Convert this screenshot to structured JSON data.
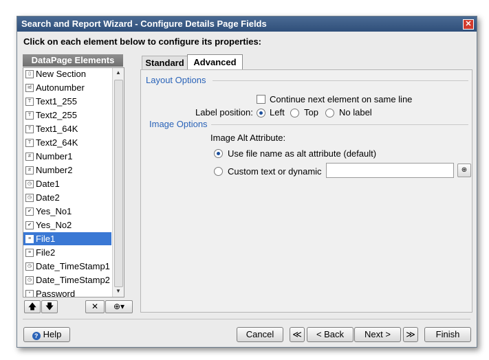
{
  "window": {
    "title": "Search and Report Wizard - Configure Details Page Fields",
    "close_glyph": "✕"
  },
  "instruction": "Click on each element below to configure its properties:",
  "left_panel": {
    "header": "DataPage Elements",
    "items": [
      {
        "label": "New Section",
        "icon": "section-icon",
        "glyph": "▯"
      },
      {
        "label": "Autonumber",
        "icon": "autonumber-icon",
        "glyph": "id"
      },
      {
        "label": "Text1_255",
        "icon": "text-field-icon",
        "glyph": "T"
      },
      {
        "label": "Text2_255",
        "icon": "text-field-icon",
        "glyph": "T"
      },
      {
        "label": "Text1_64K",
        "icon": "memo-field-icon",
        "glyph": "T"
      },
      {
        "label": "Text2_64K",
        "icon": "memo-field-icon",
        "glyph": "T"
      },
      {
        "label": "Number1",
        "icon": "number-field-icon",
        "glyph": "#"
      },
      {
        "label": "Number2",
        "icon": "number-field-icon",
        "glyph": "#"
      },
      {
        "label": "Date1",
        "icon": "date-field-icon",
        "glyph": "◷"
      },
      {
        "label": "Date2",
        "icon": "date-field-icon",
        "glyph": "◷"
      },
      {
        "label": "Yes_No1",
        "icon": "checkbox-field-icon",
        "glyph": "✔"
      },
      {
        "label": "Yes_No2",
        "icon": "checkbox-field-icon",
        "glyph": "✔"
      },
      {
        "label": "File1",
        "icon": "file-field-icon",
        "glyph": "≡",
        "selected": true
      },
      {
        "label": "File2",
        "icon": "file-field-icon",
        "glyph": "≡"
      },
      {
        "label": "Date_TimeStamp1",
        "icon": "timestamp-field-icon",
        "glyph": "◷"
      },
      {
        "label": "Date_TimeStamp2",
        "icon": "timestamp-field-icon",
        "glyph": "◷"
      },
      {
        "label": "Password",
        "icon": "password-field-icon",
        "glyph": "*"
      }
    ],
    "tools": {
      "up": "🡅",
      "down": "🡇",
      "delete": "✕",
      "insert": "⊕▾"
    }
  },
  "tabs": [
    {
      "label": "Standard"
    },
    {
      "label": "Advanced",
      "active": true
    }
  ],
  "layout_options": {
    "section_label": "Layout Options",
    "continue_checkbox_label": "Continue next element on same line",
    "continue_checked": false,
    "label_position_label": "Label position:",
    "positions": [
      {
        "label": "Left",
        "selected": true
      },
      {
        "label": "Top",
        "selected": false
      },
      {
        "label": "No label",
        "selected": false
      }
    ]
  },
  "image_options": {
    "section_label": "Image Options",
    "alt_attribute_label": "Image Alt Attribute:",
    "option_filename": "Use file name as alt attribute (default)",
    "option_custom": "Custom text or dynamic",
    "custom_value": "",
    "picker_glyph": "⊕"
  },
  "footer": {
    "help": "Help",
    "cancel": "Cancel",
    "first": "≪",
    "back": "< Back",
    "next": "Next >",
    "last": "≫",
    "finish": "Finish"
  },
  "colors": {
    "accent": "#2a63b8",
    "selection": "#3a78d4",
    "title_bar": "#3a5a85"
  }
}
